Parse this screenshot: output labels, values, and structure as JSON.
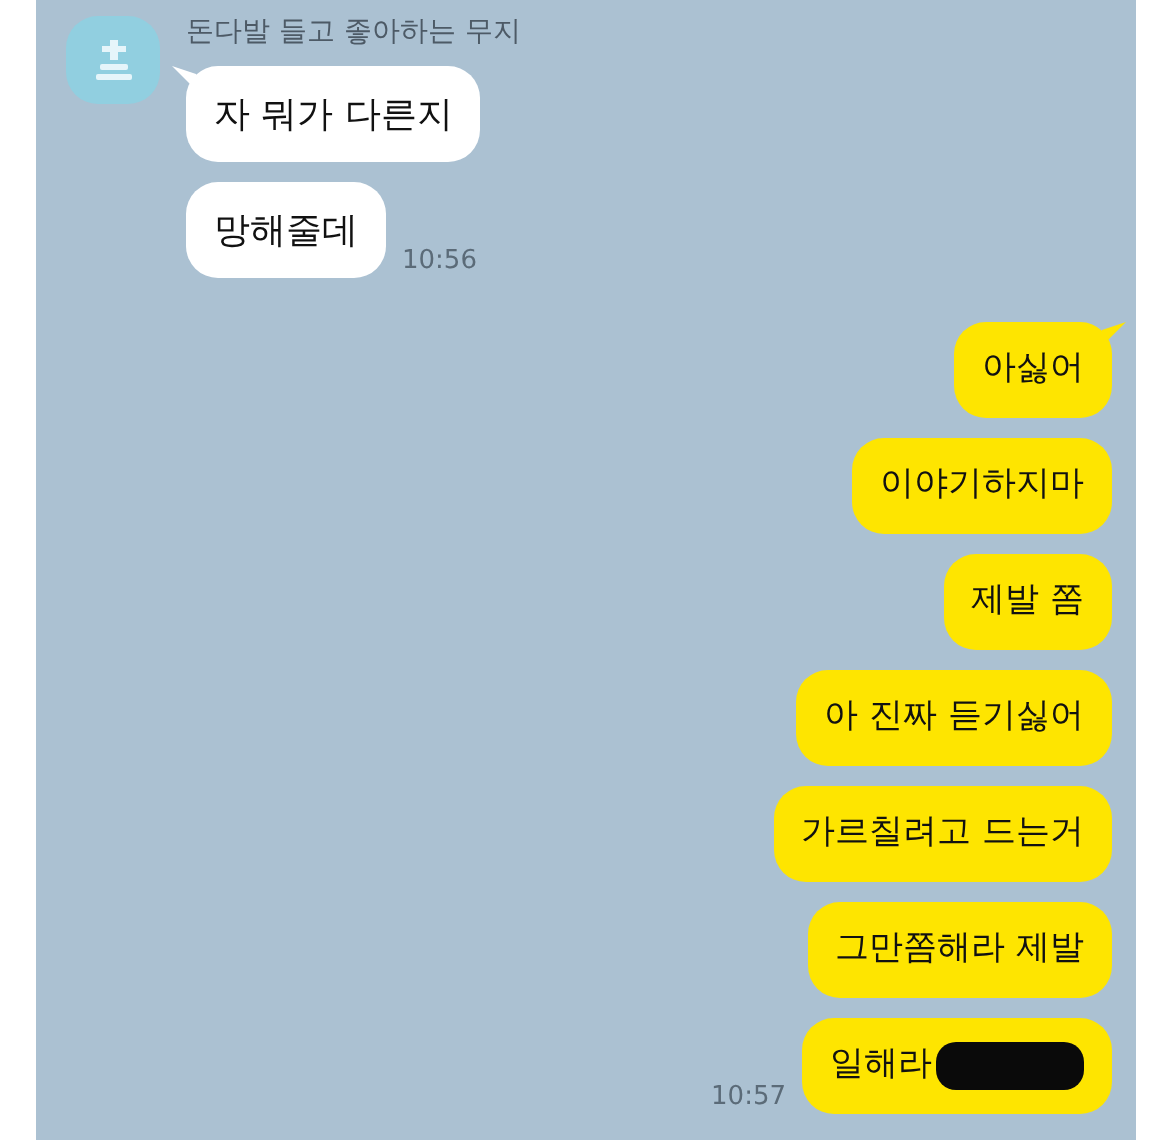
{
  "incoming": {
    "sender": "돈다발 들고 좋아하는 무지",
    "messages": [
      {
        "text": "자 뭐가 다른지",
        "tail": true
      },
      {
        "text": "망해줄데",
        "tail": false,
        "time": "10:56"
      }
    ]
  },
  "outgoing": {
    "messages": [
      {
        "text": "아싫어",
        "tail": true
      },
      {
        "text": "이야기하지마",
        "tail": false
      },
      {
        "text": "제발 쫌",
        "tail": false
      },
      {
        "text": "아 진짜 듣기싫어",
        "tail": false
      },
      {
        "text": "가르칠려고 드는거",
        "tail": false
      },
      {
        "text": "그만쫌해라 제발",
        "tail": false
      },
      {
        "text": "일해라",
        "tail": false,
        "redacted": true,
        "time": "10:57"
      }
    ]
  }
}
